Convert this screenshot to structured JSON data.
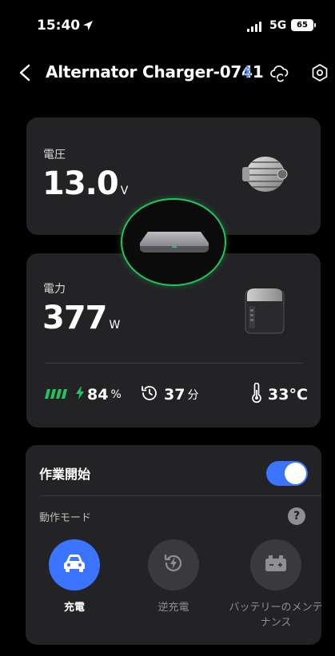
{
  "status_bar": {
    "time": "15:40",
    "network": "5G",
    "battery": "65",
    "icons": [
      "location-arrow-icon",
      "signal-icon",
      "battery-icon"
    ]
  },
  "header": {
    "title": "Alternator Charger-0741",
    "icons": [
      "back-chevron-icon",
      "bluetooth-icon",
      "cloud-sync-icon",
      "settings-gear-icon"
    ]
  },
  "voltage_card": {
    "label": "電圧",
    "value": "13.0",
    "unit": "V",
    "image": "alternator-image"
  },
  "power_card": {
    "label": "電力",
    "value": "377",
    "unit": "W",
    "image": "portable-power-station-image",
    "stats": {
      "battery_percent": "84",
      "battery_unit": "%",
      "time_value": "37",
      "time_unit": "分",
      "temperature": "33°C"
    }
  },
  "center_device": {
    "image": "alternator-charger-device-image",
    "ring_color": "#22c55e"
  },
  "control_card": {
    "toggle_label": "作業開始",
    "toggle_on": true,
    "mode_label": "動作モード",
    "help": "?",
    "modes": [
      {
        "label": "充電",
        "icon": "car-icon",
        "active": true
      },
      {
        "label": "逆充電",
        "icon": "reverse-charge-icon",
        "active": false
      },
      {
        "label": "バッテリーのメンテナンス",
        "icon": "battery-maintenance-icon",
        "active": false
      }
    ]
  },
  "colors": {
    "accent_blue": "#3b74ff",
    "accent_green": "#22c55e",
    "card_bg": "#232326",
    "bluetooth": "#4f7cff"
  }
}
